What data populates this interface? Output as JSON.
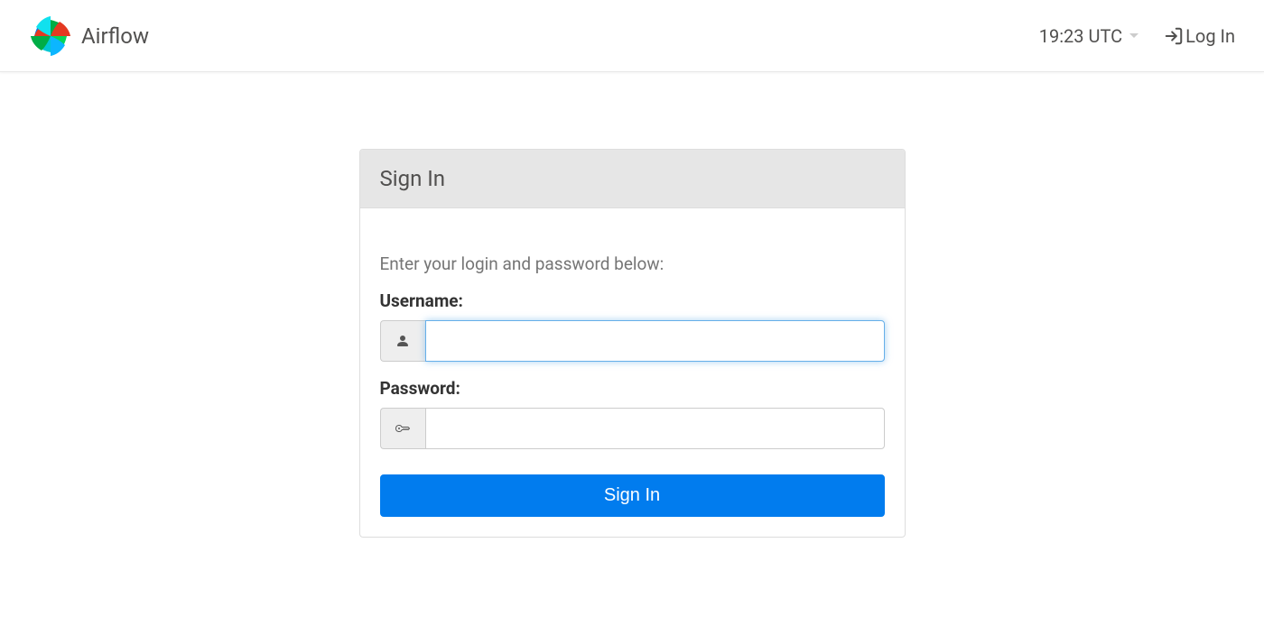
{
  "header": {
    "brand": "Airflow",
    "time": "19:23 UTC",
    "login_link": "Log In"
  },
  "panel": {
    "title": "Sign In",
    "help_text": "Enter your login and password below:",
    "username_label": "Username:",
    "username_value": "",
    "password_label": "Password:",
    "password_value": "",
    "submit_label": "Sign In"
  }
}
